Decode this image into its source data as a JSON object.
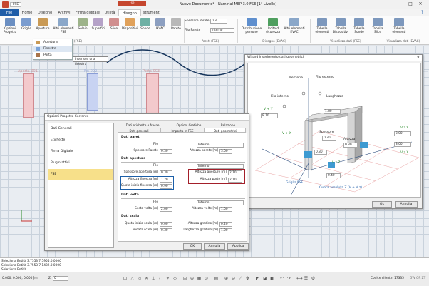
{
  "app": {
    "file_chip": "FSE",
    "ctx_tab": "Fse",
    "title": "Nuovo Documento* - Namirial MEP 3.0 FSE [1° Livello]"
  },
  "tabs": [
    "File",
    "Home",
    "Disegno",
    "Archivi",
    "Firma digitale",
    "Utilità",
    "disegno",
    "strumenti"
  ],
  "ribbon": {
    "buttons": [
      {
        "label": "Opzioni\nProgetto",
        "icon": "gear-icon",
        "color": "#6b8fc2"
      },
      {
        "label": "Griglie",
        "icon": "grid-icon",
        "color": "#7a9ccf"
      },
      {
        "label": "Aperture",
        "icon": "door-icon",
        "color": "#c99a55"
      },
      {
        "label": "Altri elementi\nFSE",
        "icon": "elements-icon",
        "color": "#8aa7c9"
      },
      {
        "label": "Solaio",
        "icon": "slab-icon",
        "color": "#9db38a"
      },
      {
        "label": "Superfici",
        "icon": "surface-icon",
        "color": "#b5a2c8"
      },
      {
        "label": "Slice",
        "icon": "slice-icon",
        "color": "#d08f8f"
      },
      {
        "label": "Dispositivi",
        "icon": "device-icon",
        "color": "#e0a15a"
      },
      {
        "label": "Sonde",
        "icon": "probe-icon",
        "color": "#6fb0a4"
      },
      {
        "label": "HVAC",
        "icon": "hvac-icon",
        "color": "#8c9fc0"
      },
      {
        "label": "Parete",
        "icon": "wall-icon",
        "color": "#b8b8b8"
      }
    ],
    "wall": {
      "thickness_label": "Spessore Parete",
      "thickness_value": "0.3",
      "wire_label": "Filo Parete",
      "wire_value": "Interno"
    },
    "evac_buttons": [
      {
        "label": "Distribuzione\npersone",
        "icon": "people-icon",
        "color": "#5f8fce"
      },
      {
        "label": "Uscita di\nsicurezza",
        "icon": "exit-icon",
        "color": "#4f9f5f"
      },
      {
        "label": "Altri elementi\nEVAC",
        "icon": "evac-icon",
        "color": "#8aa7c9"
      }
    ],
    "view_buttons": [
      {
        "label": "Tabella\nelementi",
        "icon": "table-icon",
        "color": "#7d98bd"
      },
      {
        "label": "Tabella\nDispositivi",
        "icon": "table-icon",
        "color": "#7d98bd"
      },
      {
        "label": "Tabella\nSonde",
        "icon": "table-icon",
        "color": "#7d98bd"
      },
      {
        "label": "Tabella\nSlice",
        "icon": "table-icon",
        "color": "#7d98bd"
      },
      {
        "label": "Tabella\nelementi",
        "icon": "table-icon",
        "color": "#7d98bd"
      }
    ],
    "groups": [
      "Disegno (FSE)",
      "Pareti (FSE)",
      "Disegno (EVAC)",
      "Visualizza dati (FSE)",
      "Visualizza dati (EVAC)"
    ]
  },
  "dropdown": {
    "items": [
      "Apertura generica",
      "Finestra",
      "Porta"
    ],
    "tooltip": "Inserisce una finestra"
  },
  "canvas": {
    "labels": [
      "Aperta 001",
      "Fin 002",
      "Porta 003"
    ]
  },
  "options": {
    "title": "Opzioni Progetto Corrente",
    "nav": [
      "Dati Generali",
      "Etichette",
      "Firma Digitale",
      "Plugin attivi",
      "FSE"
    ],
    "tabs_row1": [
      "Dati etichette e frecce",
      "Opzioni Grafiche",
      "Relazione"
    ],
    "tabs_row2": [
      "Dati generali",
      "Imposta in FSE",
      "Dati geometrici"
    ],
    "pareti": {
      "title": "Dati pareti",
      "filo_label": "Filo",
      "filo_value": "Interno",
      "spessore_label": "Spessore Parete",
      "spessore_value": "0.30",
      "altezza_label": "Altezza parete [m]",
      "altezza_value": "3.00"
    },
    "aperture": {
      "title": "Dati aperture",
      "filo_label": "Filo",
      "filo_value": "Interno",
      "sp_label": "Spessore apertura [m]",
      "sp_value": "0.30",
      "alt_ap_label": "Altezza aperture [m]",
      "alt_ap_value": "2.10",
      "alt_fin_label": "Altezza finestra [m]",
      "alt_fin_value": "1.20",
      "alt_porte_label": "Altezza porte [m]",
      "alt_porte_value": "2.10",
      "quota_label": "Quota inizio finestra [m]",
      "quota_value": "0.90"
    },
    "volta": {
      "title": "Dati volta",
      "filo_label": "Filo",
      "filo_value": "Interno",
      "sp_label": "Sesto volta [m]",
      "sp_value": "2.00",
      "alt_label": "Altezza volte [m]",
      "alt_value": "1.00"
    },
    "scala": {
      "title": "Dati scala",
      "q_label": "Quota inizio scala [m]",
      "q_value": "0.00",
      "a_label": "Altezza gradino [m]",
      "a_value": "0.20",
      "p_label": "Pedata scala [m]",
      "p_value": "0.30",
      "l_label": "Larghezza gradino [m]",
      "l_value": "1.00"
    },
    "ok": "OK",
    "cancel": "Annulla",
    "apply": "Applica"
  },
  "wizard": {
    "title": "Wizard inserimento dati geometrici",
    "labels": {
      "mezzeria": "Mezzeria",
      "filo_esterno": "Filo esterno",
      "filo_interno": "Filo interno",
      "lunghezza": "Lunghezza",
      "spessore": "Spessore",
      "altezza": "Altezza",
      "griglia": "Griglia FSE",
      "quota": "Quota assoluta Z (V + V z)",
      "vy": "V + Y",
      "vx": "V + X",
      "vzy": "V z Y",
      "vzx": "V z X",
      "vz": "V z Z"
    },
    "values": {
      "v810": "8.10",
      "v180": "1.80",
      "v300": "3.00",
      "v030a": "0.30",
      "v030b": "0.30",
      "v030c": "0.30",
      "v040": "0.40",
      "v300b": "3.00"
    },
    "ok": "Ok",
    "cancel": "Annulla"
  },
  "status": {
    "line1": "Seleziona Entità 3.7553.7.5955.0.0000",
    "line2": "Seleziona Entità 3.7553.7.1482.0.0000",
    "line3": "Seleziona Entità"
  },
  "bottom": {
    "coords": "0.000, 0.000, 0.000 [m]",
    "z_label": "Z",
    "z_value": "0",
    "client": "Codice cliente: 17335",
    "gw": "GW OR ZT"
  }
}
